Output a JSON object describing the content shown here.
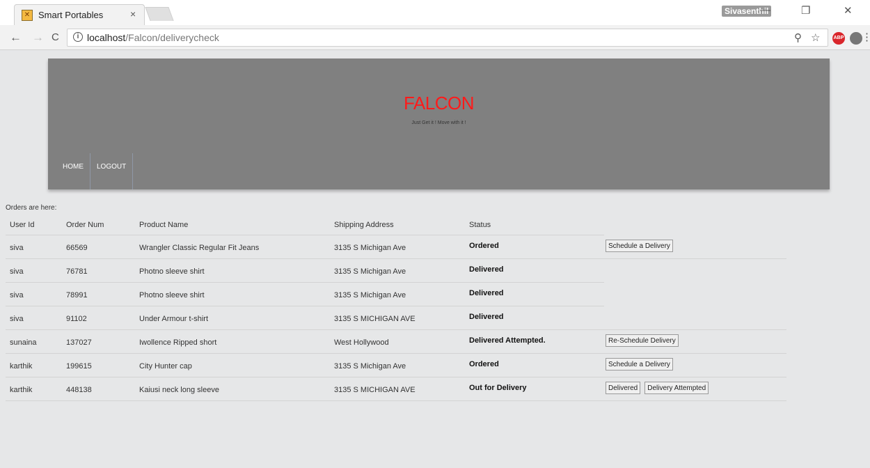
{
  "browser": {
    "tab_title": "Smart Portables",
    "tab_close": "×",
    "profile_name": "Sivasenthil",
    "url_host": "localhost",
    "url_path": "/Falcon/deliverycheck",
    "ext_abp": "ABP",
    "back_icon": "←",
    "forward_icon": "→",
    "reload_icon": "C",
    "info_icon": "i",
    "zoom_icon": "⚲",
    "star_icon": "☆",
    "menu_icon": "⋮",
    "minimize_icon": "—",
    "restore_icon": "❐",
    "close_icon": "✕"
  },
  "header": {
    "brand": "FALCON",
    "tagline": "Just Get it ! Move with it !",
    "nav": [
      {
        "label": "HOME"
      },
      {
        "label": "LOGOUT"
      }
    ]
  },
  "orders_label": "Orders are here:",
  "table": {
    "columns": [
      "User Id",
      "Order Num",
      "Product Name",
      "Shipping Address",
      "Status"
    ],
    "rows": [
      {
        "user": "siva",
        "order": "66569",
        "product": "Wrangler Classic Regular Fit Jeans",
        "address": "3135 S Michigan Ave",
        "status": "Ordered",
        "actions": [
          "Schedule a Delivery"
        ]
      },
      {
        "user": "siva",
        "order": "76781",
        "product": "Photno sleeve shirt",
        "address": "3135 S Michigan Ave",
        "status": "Delivered",
        "actions": []
      },
      {
        "user": "siva",
        "order": "78991",
        "product": "Photno sleeve shirt",
        "address": "3135 S Michigan Ave",
        "status": "Delivered",
        "actions": []
      },
      {
        "user": "siva",
        "order": "91102",
        "product": "Under Armour t-shirt",
        "address": "3135 S MICHIGAN AVE",
        "status": "Delivered",
        "actions": []
      },
      {
        "user": "sunaina",
        "order": "137027",
        "product": "Iwollence Ripped short",
        "address": "West Hollywood",
        "status": "Delivered Attempted.",
        "actions": [
          "Re-Schedule Delivery"
        ]
      },
      {
        "user": "karthik",
        "order": "199615",
        "product": "City Hunter cap",
        "address": "3135 S Michigan Ave",
        "status": "Ordered",
        "actions": [
          "Schedule a Delivery"
        ]
      },
      {
        "user": "karthik",
        "order": "448138",
        "product": "Kaiusi neck long sleeve",
        "address": "3135 S MICHIGAN AVE",
        "status": "Out for Delivery",
        "actions": [
          "Delivered",
          "Delivery Attempted"
        ]
      }
    ]
  }
}
